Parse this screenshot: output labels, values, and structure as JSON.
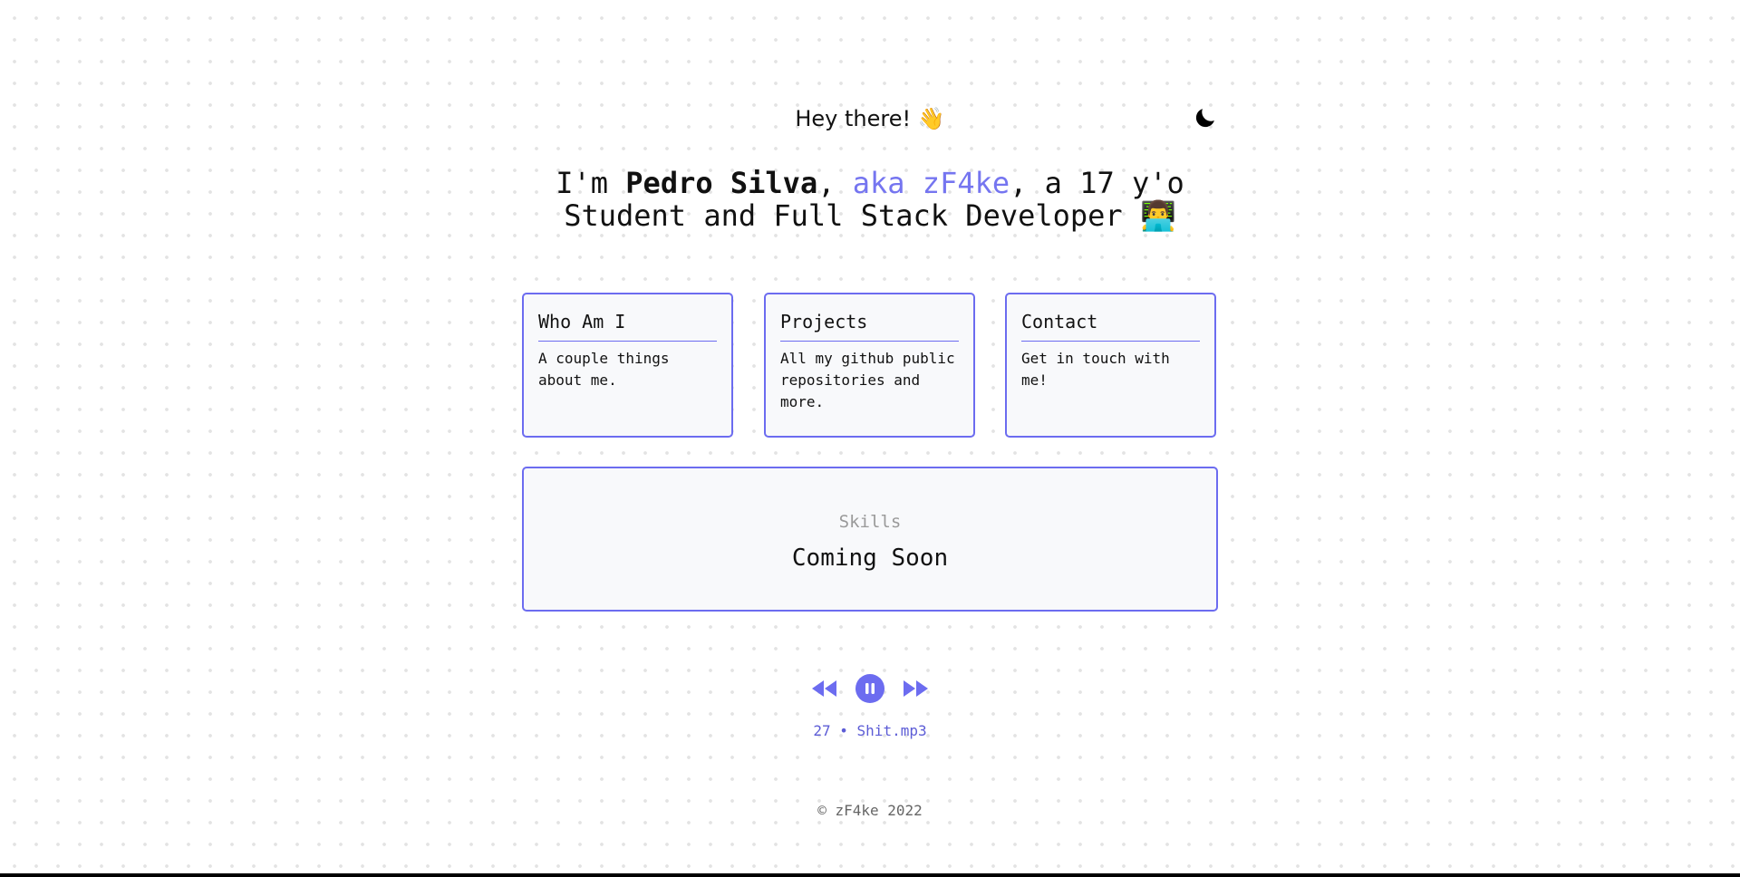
{
  "header": {
    "greeting": "Hey there! 👋",
    "theme_toggle_icon": "moon-icon"
  },
  "intro": {
    "prefix": "I'm ",
    "name": "Pedro Silva",
    "comma": ", ",
    "alias": "aka zF4ke",
    "suffix_line1": ", a 17 y'o",
    "line2": "Student and Full Stack Developer 👨‍💻"
  },
  "cards": [
    {
      "title": "Who Am I",
      "description": "A couple things about me."
    },
    {
      "title": "Projects",
      "description": "All my github public repositories and more."
    },
    {
      "title": "Contact",
      "description": "Get in touch with me!"
    }
  ],
  "skills": {
    "label": "Skills",
    "status": "Coming Soon"
  },
  "player": {
    "controls": [
      "rewind-icon",
      "pause-icon",
      "fast-forward-icon"
    ],
    "track": "27 • Shit.mp3"
  },
  "footer": {
    "copyright": "© zF4ke 2022"
  },
  "colors": {
    "accent": "#6c6cf0",
    "alias": "#7575f0",
    "card_background": "#f8f9fb",
    "muted_text": "#9a9a9a"
  }
}
